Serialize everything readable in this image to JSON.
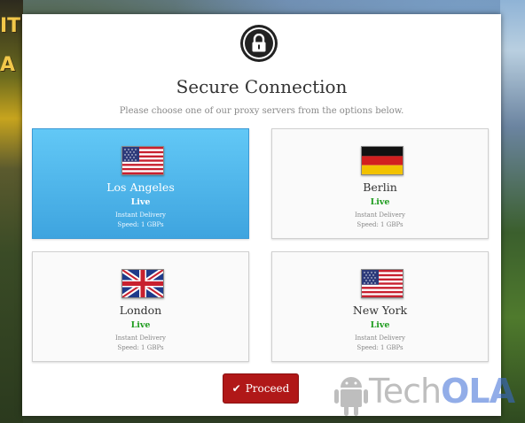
{
  "modal": {
    "title": "Secure Connection",
    "subtitle": "Please choose one of our proxy servers from the options below."
  },
  "servers": [
    {
      "city": "Los Angeles",
      "status": "Live",
      "delivery": "Instant Delivery",
      "speed": "Speed: 1 GBPs",
      "flag": "us-flag",
      "selected": true
    },
    {
      "city": "Berlin",
      "status": "Live",
      "delivery": "Instant Delivery",
      "speed": "Speed: 1 GBPs",
      "flag": "de-flag",
      "selected": false
    },
    {
      "city": "London",
      "status": "Live",
      "delivery": "Instant Delivery",
      "speed": "Speed: 1 GBPs",
      "flag": "uk-flag",
      "selected": false
    },
    {
      "city": "New York",
      "status": "Live",
      "delivery": "Instant Delivery",
      "speed": "Speed: 1 GBPs",
      "flag": "us-flag",
      "selected": false
    }
  ],
  "action": {
    "proceed_label": "Proceed"
  },
  "watermark": {
    "text_a": "Tech",
    "text_b": "OLA"
  },
  "background": {
    "game_title": "ITE\nA"
  },
  "colors": {
    "selected_card": "#3ea4df",
    "live_status": "#1e9c1e",
    "proceed_button": "#b01818"
  },
  "icons": [
    "lock-icon",
    "check-icon",
    "us-flag",
    "de-flag",
    "uk-flag",
    "android-icon"
  ]
}
